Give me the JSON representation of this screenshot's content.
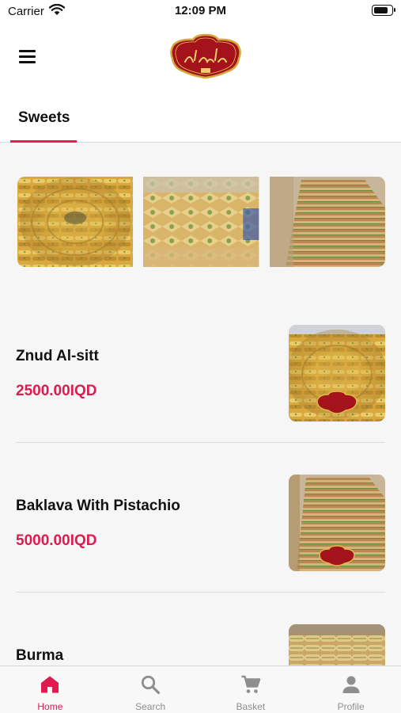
{
  "status_bar": {
    "carrier": "Carrier",
    "time": "12:09 PM",
    "battery_level": 0.85
  },
  "header": {
    "logo_icon": "brand-logo",
    "menu_icon": "hamburger-menu-icon"
  },
  "category_tabs": [
    {
      "label": "Sweets",
      "active": true
    }
  ],
  "banner": {
    "images": [
      "znud-al-sitt-photo",
      "baklava-tray-photo",
      "baklava-pyramid-photo"
    ]
  },
  "products": [
    {
      "name": "Znud Al-sitt",
      "price": "2500.00IQD",
      "image": "znud-al-sitt-photo"
    },
    {
      "name": "Baklava With Pistachio",
      "price": "5000.00IQD",
      "image": "baklava-pyramid-photo"
    },
    {
      "name": "Burma",
      "price": "",
      "image": "burma-photo"
    }
  ],
  "tab_bar": {
    "items": [
      {
        "label": "Home",
        "icon": "home-icon",
        "active": true
      },
      {
        "label": "Search",
        "icon": "search-icon",
        "active": false
      },
      {
        "label": "Basket",
        "icon": "cart-icon",
        "active": false
      },
      {
        "label": "Profile",
        "icon": "person-icon",
        "active": false
      }
    ]
  },
  "colors": {
    "accent": "#e01a4f",
    "inactive": "#8e8e8e",
    "background": "#f6f6f6"
  }
}
